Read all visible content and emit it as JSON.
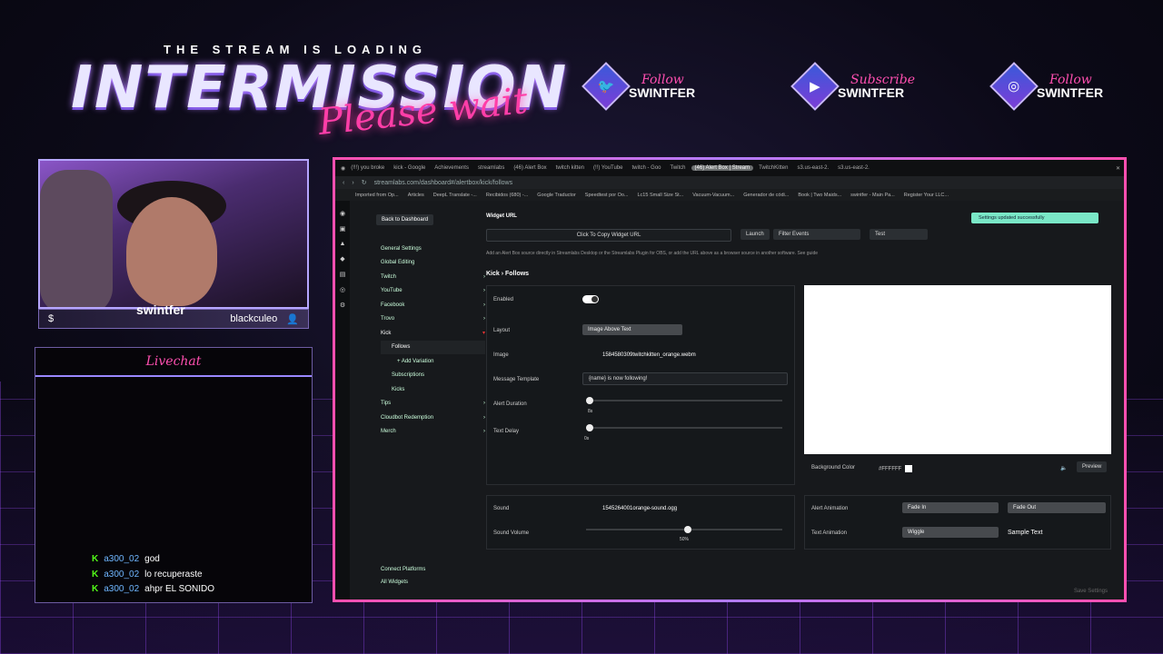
{
  "overlay": {
    "tagline": "THE STREAM IS LOADING",
    "title": "INTERMISSION",
    "subtitle": "Please wait",
    "socials": [
      {
        "verb": "Follow",
        "name": "SWINTFER",
        "icon": "twitter-icon"
      },
      {
        "verb": "Subscribe",
        "name": "SWINTFER",
        "icon": "youtube-icon"
      },
      {
        "verb": "Follow",
        "name": "SWINTFER",
        "icon": "instagram-icon"
      }
    ],
    "cam_name": "swintfer",
    "cam_tag": "blackculeo",
    "chat_title": "Livechat",
    "chat": [
      {
        "user": "a300_02",
        "text": "god"
      },
      {
        "user": "a300_02",
        "text": "lo recuperaste"
      },
      {
        "user": "a300_02",
        "text": "ahpr EL SONIDO"
      }
    ]
  },
  "browser": {
    "tabs": [
      "(!!!) you broke",
      "kick - Google",
      "Achievements",
      "streamlabs",
      "(46) Alert Box",
      "twitch kitten",
      "(!!) YouTube",
      "twitch - Goo",
      "Twitch",
      "(46) Alert Box | Stream",
      "TwitchKitten",
      "s3.us-east-2.",
      "s3.us-east-2."
    ],
    "active_tab": 9,
    "url": "streamlabs.com/dashboard#/alertbox/kick/follows",
    "bookmarks": [
      "Imported from Op...",
      "Articles",
      "DeepL Translate -...",
      "Recibidos (680) -...",
      "Google Traductor",
      "Speedtest por Oo...",
      "Lc15 Small Size St...",
      "Vacuum-Vacuum...",
      "Generador de códi...",
      "Book | Two Maids...",
      "swintfer - Main Pa...",
      "Register Your LLC..."
    ]
  },
  "sidebar": {
    "back": "Back to Dashboard",
    "items": [
      {
        "label": "General Settings",
        "arrow": ""
      },
      {
        "label": "Global Editing",
        "arrow": ""
      },
      {
        "label": "Twitch",
        "arrow": "›"
      },
      {
        "label": "YouTube",
        "arrow": "›"
      },
      {
        "label": "Facebook",
        "arrow": "›"
      },
      {
        "label": "Trovo",
        "arrow": "›"
      },
      {
        "label": "Kick",
        "arrow": "▾"
      },
      {
        "label": "Follows",
        "arrow": ""
      },
      {
        "label": "+ Add Variation",
        "arrow": ""
      },
      {
        "label": "Subscriptions",
        "arrow": ""
      },
      {
        "label": "Kicks",
        "arrow": ""
      },
      {
        "label": "Tips",
        "arrow": "›"
      },
      {
        "label": "Cloudbot Redemption",
        "arrow": "›"
      },
      {
        "label": "Merch",
        "arrow": "›"
      }
    ],
    "connect": "Connect Platforms",
    "all_widgets": "All Widgets"
  },
  "widget": {
    "url_label": "Widget URL",
    "copy": "Click To Copy Widget URL",
    "launch": "Launch",
    "filter": "Filter Events",
    "test": "Test",
    "toast": "Settings updated successfully",
    "hint": "Add an Alert Box source directly in Streamlabs Desktop or the Streamlabs Plugin for OBS, or add the URL above as a browser source in another software. See guide",
    "section": "Kick › Follows",
    "enabled_label": "Enabled",
    "layout_label": "Layout",
    "layout_value": "Image Above Text",
    "image_label": "Image",
    "image_value": "1584580309twitchkitten_orange.webm",
    "template_label": "Message Template",
    "template_value": "{name} is now following!",
    "duration_label": "Alert Duration",
    "duration_value": "8s",
    "delay_label": "Text Delay",
    "delay_value": "0s",
    "bg_label": "Background Color",
    "bg_value": "#FFFFFF",
    "preview": "Preview",
    "sound_label": "Sound",
    "sound_value": "1545264001orange-sound.ogg",
    "volume_label": "Sound Volume",
    "volume_value": "50%",
    "volume": 0.5,
    "alert_anim_label": "Alert Animation",
    "anim_in": "Fade In",
    "anim_out": "Fade Out",
    "text_anim_label": "Text Animation",
    "text_anim": "Wiggle",
    "sample": "Sample Text",
    "save": "Save Settings"
  }
}
